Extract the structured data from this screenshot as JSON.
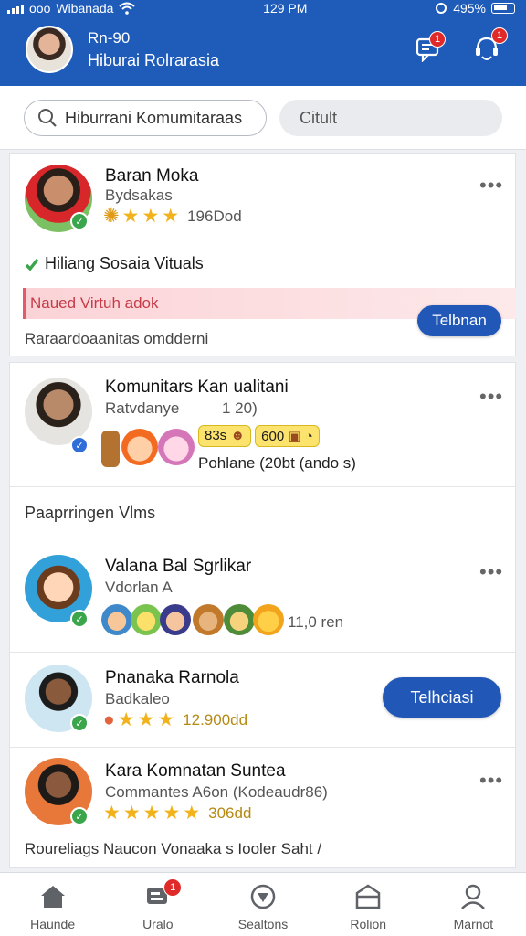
{
  "status_bar": {
    "carrier": "Wibanada",
    "carrier_prefix": "ooo",
    "time": "129 PM",
    "battery": "495%"
  },
  "header": {
    "title": "Rn-90",
    "subtitle": "Hiburai Rolrarasia",
    "messages_badge": "1",
    "notifications_badge": "1"
  },
  "search": {
    "value": "Hiburrani Komumitaraas",
    "filter_label": "Citult"
  },
  "posts": [
    {
      "name": "Baran Moka",
      "sub": "Bydsakas",
      "rating_text": "196Dod",
      "tag": "Hiliang Sosaia Vituals",
      "alert": "Naued Virtuh adok",
      "footer": "Raraardoaanitas omdderni",
      "button": "Telbnan"
    },
    {
      "name": "Komunitars Kan ualitani",
      "sub": "Ratvdanye",
      "sub_count": "1 20)",
      "chip_a": "83s",
      "chip_b": "600",
      "participants": "Pohlane (20bt (ando s)"
    }
  ],
  "section_label": "Paaprringen Vlms",
  "people": [
    {
      "name": "Valana Bal Sgrlikar",
      "sub": "Vdorlan A",
      "count": "11,0 ren"
    },
    {
      "name": "Pnanaka Rarnola",
      "sub": "Badkaleo",
      "rating_text": "12.900dd",
      "button": "Telhciasi"
    },
    {
      "name": "Kara Komnatan Suntea",
      "sub": "Commantes A6on (Kodeaudr86)",
      "rating_text": "306dd",
      "footer": "Roureliags Naucon Vonaaka s Iooler Saht /"
    }
  ],
  "nav": [
    {
      "label": "Haunde",
      "icon": "home-icon"
    },
    {
      "label": "Uralo",
      "icon": "chat-icon",
      "badge": "1"
    },
    {
      "label": "Sealtons",
      "icon": "explore-icon"
    },
    {
      "label": "Rolion",
      "icon": "inbox-icon"
    },
    {
      "label": "Marnot",
      "icon": "profile-icon"
    }
  ],
  "colors": {
    "brand": "#1f5cba",
    "button": "#2157b7",
    "star": "#f1b21b",
    "verified_green": "#3aa54a",
    "verified_blue": "#2f6ed8",
    "alert_bg": "#fde0e2",
    "badge": "#e02a2a"
  }
}
